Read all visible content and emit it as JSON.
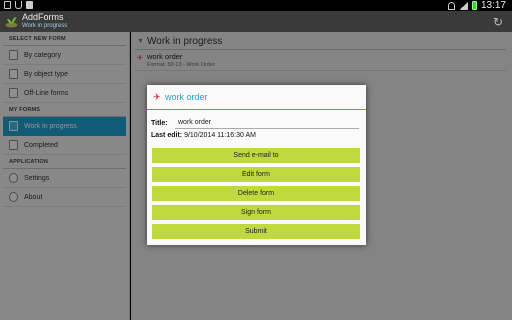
{
  "status_bar": {
    "time": "13:17",
    "left_icons": [
      "image-icon",
      "usb-icon",
      "document-icon"
    ],
    "right_icons": [
      "wifi-icon",
      "signal-icon",
      "battery-icon"
    ]
  },
  "action_bar": {
    "app_name": "AddForms",
    "subtitle": "Work in progress",
    "refresh_icon": "refresh-icon"
  },
  "sidebar": {
    "sections": [
      {
        "title": "SELECT NEW FORM",
        "items": [
          {
            "label": "By category",
            "icon": "category-icon"
          },
          {
            "label": "By object type",
            "icon": "object-type-icon"
          },
          {
            "label": "Off-Line forms",
            "icon": "offline-forms-icon"
          }
        ]
      },
      {
        "title": "MY FORMS",
        "items": [
          {
            "label": "Work in progress",
            "icon": "work-in-progress-icon",
            "active": true
          },
          {
            "label": "Completed",
            "icon": "completed-icon"
          }
        ]
      },
      {
        "title": "APPLICATION",
        "items": [
          {
            "label": "Settings",
            "icon": "settings-icon"
          },
          {
            "label": "About",
            "icon": "about-icon"
          }
        ]
      }
    ]
  },
  "main": {
    "title": "Work in progress",
    "forms": [
      {
        "name": "work order",
        "meta": "Format: 50-13 - Work Order"
      }
    ]
  },
  "dialog": {
    "title": "work order",
    "title_label": "Title:",
    "title_value": "work order",
    "last_edit_label": "Last edit:",
    "last_edit_value": "9/10/2014 11:16:30 AM",
    "buttons": [
      "Send e-mail to",
      "Edit form",
      "Delete form",
      "Sign form",
      "Submit"
    ]
  },
  "colors": {
    "accent": "#1e9ecb",
    "button": "#bfd93f",
    "pdf": "#dd2222"
  }
}
